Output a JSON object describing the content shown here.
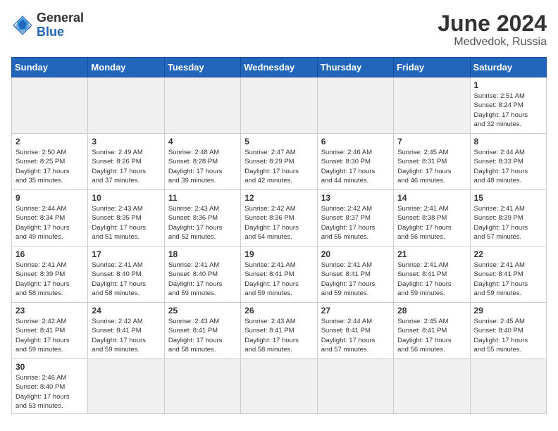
{
  "header": {
    "logo_general": "General",
    "logo_blue": "Blue",
    "month_year": "June 2024",
    "location": "Medvedok, Russia"
  },
  "days_of_week": [
    "Sunday",
    "Monday",
    "Tuesday",
    "Wednesday",
    "Thursday",
    "Friday",
    "Saturday"
  ],
  "weeks": [
    [
      {
        "day": "",
        "info": "",
        "empty": true
      },
      {
        "day": "",
        "info": "",
        "empty": true
      },
      {
        "day": "",
        "info": "",
        "empty": true
      },
      {
        "day": "",
        "info": "",
        "empty": true
      },
      {
        "day": "",
        "info": "",
        "empty": true
      },
      {
        "day": "",
        "info": "",
        "empty": true
      },
      {
        "day": "1",
        "info": "Sunrise: 2:51 AM\nSunset: 8:24 PM\nDaylight: 17 hours\nand 32 minutes."
      }
    ],
    [
      {
        "day": "2",
        "info": "Sunrise: 2:50 AM\nSunset: 8:25 PM\nDaylight: 17 hours\nand 35 minutes."
      },
      {
        "day": "3",
        "info": "Sunrise: 2:49 AM\nSunset: 8:26 PM\nDaylight: 17 hours\nand 37 minutes."
      },
      {
        "day": "4",
        "info": "Sunrise: 2:48 AM\nSunset: 8:28 PM\nDaylight: 17 hours\nand 39 minutes."
      },
      {
        "day": "5",
        "info": "Sunrise: 2:47 AM\nSunset: 8:29 PM\nDaylight: 17 hours\nand 42 minutes."
      },
      {
        "day": "6",
        "info": "Sunrise: 2:46 AM\nSunset: 8:30 PM\nDaylight: 17 hours\nand 44 minutes."
      },
      {
        "day": "7",
        "info": "Sunrise: 2:45 AM\nSunset: 8:31 PM\nDaylight: 17 hours\nand 46 minutes."
      },
      {
        "day": "8",
        "info": "Sunrise: 2:44 AM\nSunset: 8:33 PM\nDaylight: 17 hours\nand 48 minutes."
      }
    ],
    [
      {
        "day": "9",
        "info": "Sunrise: 2:44 AM\nSunset: 8:34 PM\nDaylight: 17 hours\nand 49 minutes."
      },
      {
        "day": "10",
        "info": "Sunrise: 2:43 AM\nSunset: 8:35 PM\nDaylight: 17 hours\nand 51 minutes."
      },
      {
        "day": "11",
        "info": "Sunrise: 2:43 AM\nSunset: 8:36 PM\nDaylight: 17 hours\nand 52 minutes."
      },
      {
        "day": "12",
        "info": "Sunrise: 2:42 AM\nSunset: 8:36 PM\nDaylight: 17 hours\nand 54 minutes."
      },
      {
        "day": "13",
        "info": "Sunrise: 2:42 AM\nSunset: 8:37 PM\nDaylight: 17 hours\nand 55 minutes."
      },
      {
        "day": "14",
        "info": "Sunrise: 2:41 AM\nSunset: 8:38 PM\nDaylight: 17 hours\nand 56 minutes."
      },
      {
        "day": "15",
        "info": "Sunrise: 2:41 AM\nSunset: 8:39 PM\nDaylight: 17 hours\nand 57 minutes."
      }
    ],
    [
      {
        "day": "16",
        "info": "Sunrise: 2:41 AM\nSunset: 8:39 PM\nDaylight: 17 hours\nand 58 minutes."
      },
      {
        "day": "17",
        "info": "Sunrise: 2:41 AM\nSunset: 8:40 PM\nDaylight: 17 hours\nand 58 minutes."
      },
      {
        "day": "18",
        "info": "Sunrise: 2:41 AM\nSunset: 8:40 PM\nDaylight: 17 hours\nand 59 minutes."
      },
      {
        "day": "19",
        "info": "Sunrise: 2:41 AM\nSunset: 8:41 PM\nDaylight: 17 hours\nand 59 minutes."
      },
      {
        "day": "20",
        "info": "Sunrise: 2:41 AM\nSunset: 8:41 PM\nDaylight: 17 hours\nand 59 minutes."
      },
      {
        "day": "21",
        "info": "Sunrise: 2:41 AM\nSunset: 8:41 PM\nDaylight: 17 hours\nand 59 minutes."
      },
      {
        "day": "22",
        "info": "Sunrise: 2:41 AM\nSunset: 8:41 PM\nDaylight: 17 hours\nand 59 minutes."
      }
    ],
    [
      {
        "day": "23",
        "info": "Sunrise: 2:42 AM\nSunset: 8:41 PM\nDaylight: 17 hours\nand 59 minutes."
      },
      {
        "day": "24",
        "info": "Sunrise: 2:42 AM\nSunset: 8:41 PM\nDaylight: 17 hours\nand 59 minutes."
      },
      {
        "day": "25",
        "info": "Sunrise: 2:43 AM\nSunset: 8:41 PM\nDaylight: 17 hours\nand 58 minutes."
      },
      {
        "day": "26",
        "info": "Sunrise: 2:43 AM\nSunset: 8:41 PM\nDaylight: 17 hours\nand 58 minutes."
      },
      {
        "day": "27",
        "info": "Sunrise: 2:44 AM\nSunset: 8:41 PM\nDaylight: 17 hours\nand 57 minutes."
      },
      {
        "day": "28",
        "info": "Sunrise: 2:45 AM\nSunset: 8:41 PM\nDaylight: 17 hours\nand 56 minutes."
      },
      {
        "day": "29",
        "info": "Sunrise: 2:45 AM\nSunset: 8:40 PM\nDaylight: 17 hours\nand 55 minutes."
      }
    ],
    [
      {
        "day": "30",
        "info": "Sunrise: 2:46 AM\nSunset: 8:40 PM\nDaylight: 17 hours\nand 53 minutes."
      },
      {
        "day": "",
        "info": "",
        "empty": true
      },
      {
        "day": "",
        "info": "",
        "empty": true
      },
      {
        "day": "",
        "info": "",
        "empty": true
      },
      {
        "day": "",
        "info": "",
        "empty": true
      },
      {
        "day": "",
        "info": "",
        "empty": true
      },
      {
        "day": "",
        "info": "",
        "empty": true
      }
    ]
  ]
}
